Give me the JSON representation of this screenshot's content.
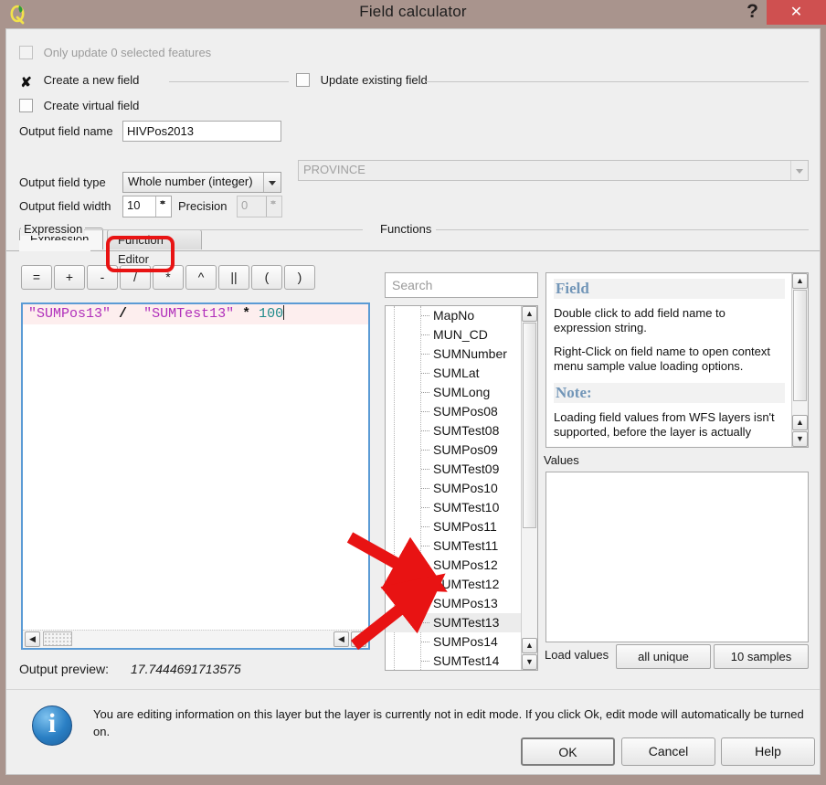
{
  "window": {
    "title": "Field calculator",
    "app_icon": "qgis-logo-icon",
    "help_label": "?",
    "close_label": "✕"
  },
  "options": {
    "only_update_selected_label": "Only update 0 selected features",
    "only_update_selected_checked": false,
    "create_new_field_label": "Create a new field",
    "create_new_field_checked": true,
    "create_new_field_mark": "✘",
    "update_existing_field_label": "Update existing field",
    "update_existing_field_checked": false,
    "create_virtual_field_label": "Create virtual field",
    "create_virtual_field_checked": false
  },
  "fields_form": {
    "output_field_name_label": "Output field name",
    "output_field_name_value": "HIVPos2013",
    "output_field_type_label": "Output field type",
    "output_field_type_value": "Whole number (integer)",
    "output_field_width_label": "Output field width",
    "output_field_width_value": "10",
    "precision_label": "Precision",
    "precision_value": "0",
    "existing_field_value": "PROVINCE"
  },
  "tabs": [
    {
      "label": "Expression",
      "active": true
    },
    {
      "label": "Function Editor",
      "active": false
    }
  ],
  "expression_group": {
    "legend": "Expression",
    "operators": [
      "=",
      "+",
      "-",
      "/",
      "*",
      "^",
      "||",
      "(",
      ")"
    ],
    "highlighted_operators": [
      "/",
      "*"
    ],
    "expression_tokens": [
      {
        "text": "\"SUMPos13\"",
        "type": "field"
      },
      {
        "text": " ",
        "type": "space"
      },
      {
        "text": "/",
        "type": "op"
      },
      {
        "text": "  ",
        "type": "space"
      },
      {
        "text": "\"SUMTest13\"",
        "type": "field"
      },
      {
        "text": " ",
        "type": "space"
      },
      {
        "text": "*",
        "type": "op"
      },
      {
        "text": " ",
        "type": "space"
      },
      {
        "text": "100",
        "type": "num"
      }
    ],
    "expression_plain": "\"SUMPos13\" /  \"SUMTest13\" * 100",
    "scroll_left_icon": "◀",
    "scroll_right_icon": "▶"
  },
  "functions_group": {
    "legend": "Functions",
    "search_placeholder": "Search",
    "search_value": "",
    "field_list": [
      {
        "name": "MapNo",
        "selected": false
      },
      {
        "name": "MUN_CD",
        "selected": false
      },
      {
        "name": "SUMNumber",
        "selected": false
      },
      {
        "name": "SUMLat",
        "selected": false
      },
      {
        "name": "SUMLong",
        "selected": false
      },
      {
        "name": "SUMPos08",
        "selected": false
      },
      {
        "name": "SUMTest08",
        "selected": false
      },
      {
        "name": "SUMPos09",
        "selected": false
      },
      {
        "name": "SUMTest09",
        "selected": false
      },
      {
        "name": "SUMPos10",
        "selected": false
      },
      {
        "name": "SUMTest10",
        "selected": false
      },
      {
        "name": "SUMPos11",
        "selected": false
      },
      {
        "name": "SUMTest11",
        "selected": false
      },
      {
        "name": "SUMPos12",
        "selected": false
      },
      {
        "name": "SUMTest12",
        "selected": false
      },
      {
        "name": "SUMPos13",
        "selected": false
      },
      {
        "name": "SUMTest13",
        "selected": true
      },
      {
        "name": "SUMPos14",
        "selected": false
      },
      {
        "name": "SUMTest14",
        "selected": false
      }
    ]
  },
  "help_panel": {
    "heading": "Field",
    "paragraph1": "Double click to add field name to expression string.",
    "paragraph2": "Right-Click on field name to open context menu sample value loading options.",
    "note_heading": "Note:",
    "note_text": "Loading field values from WFS layers isn't supported, before the layer is actually"
  },
  "values_panel": {
    "legend": "Values",
    "items": [],
    "load_values_label": "Load values",
    "all_unique_label": "all unique",
    "samples_label": "10 samples"
  },
  "preview": {
    "label": "Output preview:",
    "value": "17.7444691713575"
  },
  "info": {
    "icon": "info-icon",
    "message": "You are editing information on this layer but the layer is currently not in edit mode. If you click Ok, edit mode will automatically be turned on."
  },
  "buttons": {
    "ok": "OK",
    "cancel": "Cancel",
    "help": "Help"
  },
  "colors": {
    "titlebar": "#a9948d",
    "close_button": "#cf5050",
    "dialog_bg": "#efefef",
    "annotation_red": "#e81313",
    "expression_field_token": "#b02fbb",
    "expression_number_token": "#1f8a8a",
    "help_heading": "#7296b8",
    "focus_border": "#5b9bd5"
  }
}
